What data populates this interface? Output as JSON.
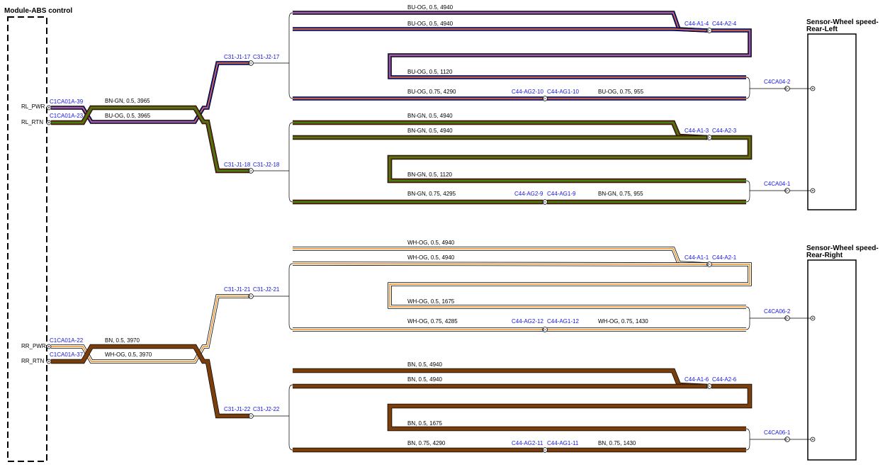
{
  "module": {
    "title": "Module-ABS control"
  },
  "sensors": [
    {
      "title_line1": "Sensor-Wheel speed-",
      "title_line2": "Rear-Left"
    },
    {
      "title_line1": "Sensor-Wheel speed-",
      "title_line2": "Rear-Right"
    }
  ],
  "pins": {
    "rl_pwr": "RL_PWR",
    "rl_rtn": "RL_RTN",
    "rr_pwr": "RR_PWR",
    "rr_rtn": "RR_RTN"
  },
  "connectors": {
    "c1_39": "C1CA01A-39",
    "c1_23": "C1CA01A-23",
    "c1_22": "C1CA01A-22",
    "c1_37": "C1CA01A-37",
    "c31_17a": "C31-J1-17",
    "c31_17b": "C31-J2-17",
    "c31_18a": "C31-J1-18",
    "c31_18b": "C31-J2-18",
    "c31_21a": "C31-J1-21",
    "c31_21b": "C31-J2-21",
    "c31_22a": "C31-J1-22",
    "c31_22b": "C31-J2-22",
    "c44_a1_4": "C44-A1-4",
    "c44_a2_4": "C44-A2-4",
    "c44_a1_3": "C44-A1-3",
    "c44_a2_3": "C44-A2-3",
    "c44_a1_1": "C44-A1-1",
    "c44_a2_1": "C44-A2-1",
    "c44_a1_6": "C44-A1-6",
    "c44_a2_6": "C44-A2-6",
    "c44_ag2_10": "C44-AG2-10",
    "c44_ag1_10": "C44-AG1-10",
    "c44_ag2_9": "C44-AG2-9",
    "c44_ag1_9": "C44-AG1-9",
    "c44_ag2_12": "C44-AG2-12",
    "c44_ag1_12": "C44-AG1-12",
    "c44_ag2_11": "C44-AG2-11",
    "c44_ag1_11": "C44-AG1-11",
    "c4ca04_2": "C4CA04-2",
    "c4ca04_1": "C4CA04-1",
    "c4ca06_2": "C4CA06-2",
    "c4ca06_1": "C4CA06-1"
  },
  "wires": {
    "rl_pwr_main": "BN-GN,  0.5,  3965",
    "rl_rtn_main": "BU-OG,  0.5,  3965",
    "bu_top1": "BU-OG,  0.5,  4940",
    "bu_top2": "BU-OG,  0.5,  4940",
    "bu_mid": "BU-OG,  0.5,  1120",
    "bu_bot_a": "BU-OG,  0.75,  4290",
    "bu_bot_b": "BU-OG,  0.75,  955",
    "bngn_top1": "BN-GN,  0.5,  4940",
    "bngn_top2": "BN-GN,  0.5,  4940",
    "bngn_mid": "BN-GN,  0.5,  1120",
    "bngn_bot_a": "BN-GN,  0.75,  4295",
    "bngn_bot_b": "BN-GN,  0.75,  955",
    "rr_pwr_main": "BN,  0.5,  3970",
    "rr_rtn_main": "WH-OG,  0.5,  3970",
    "wh_top1": "WH-OG,  0.5,  4940",
    "wh_top2": "WH-OG,  0.5,  4940",
    "wh_mid": "WH-OG,  0.5,  1675",
    "wh_bot_a": "WH-OG,  0.75,  4285",
    "wh_bot_b": "WH-OG,  0.75,  1430",
    "bn_top1": "BN,  0.5,  4940",
    "bn_top2": "BN,  0.5,  4940",
    "bn_mid": "BN,  0.5,  1675",
    "bn_bot_a": "BN,  0.75,  4290",
    "bn_bot_b": "BN,  0.75,  1430"
  },
  "colors": {
    "bu_og": [
      "#1a1aa8",
      "#f07828"
    ],
    "bn_gn": [
      "#6b3a10",
      "#3d8a10"
    ],
    "wh_og": [
      "#ffffff",
      "#f08c1e"
    ],
    "bn": [
      "#7a3e0c",
      "#7a3e0c"
    ],
    "connector_text": "#1515e0"
  }
}
